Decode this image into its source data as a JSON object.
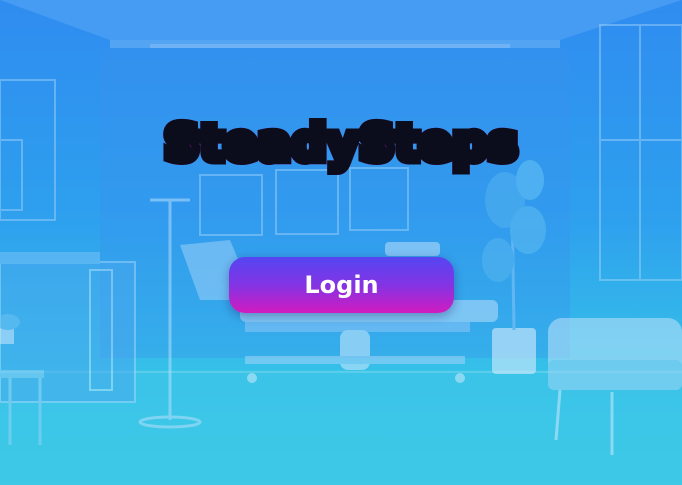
{
  "app": {
    "title": "SteadySteps"
  },
  "actions": {
    "login_label": "Login"
  },
  "colors": {
    "background_top": "#2f8cf0",
    "background_bottom": "#3ccce6",
    "title_gradient_start": "#b324f2",
    "title_gradient_end": "#e214b9",
    "title_outline": "#0b0d1c",
    "button_gradient_start": "#5546f2",
    "button_gradient_end": "#d21bbf",
    "button_text": "#ffffff"
  },
  "background": {
    "scene": "clinic-room-illustration"
  }
}
